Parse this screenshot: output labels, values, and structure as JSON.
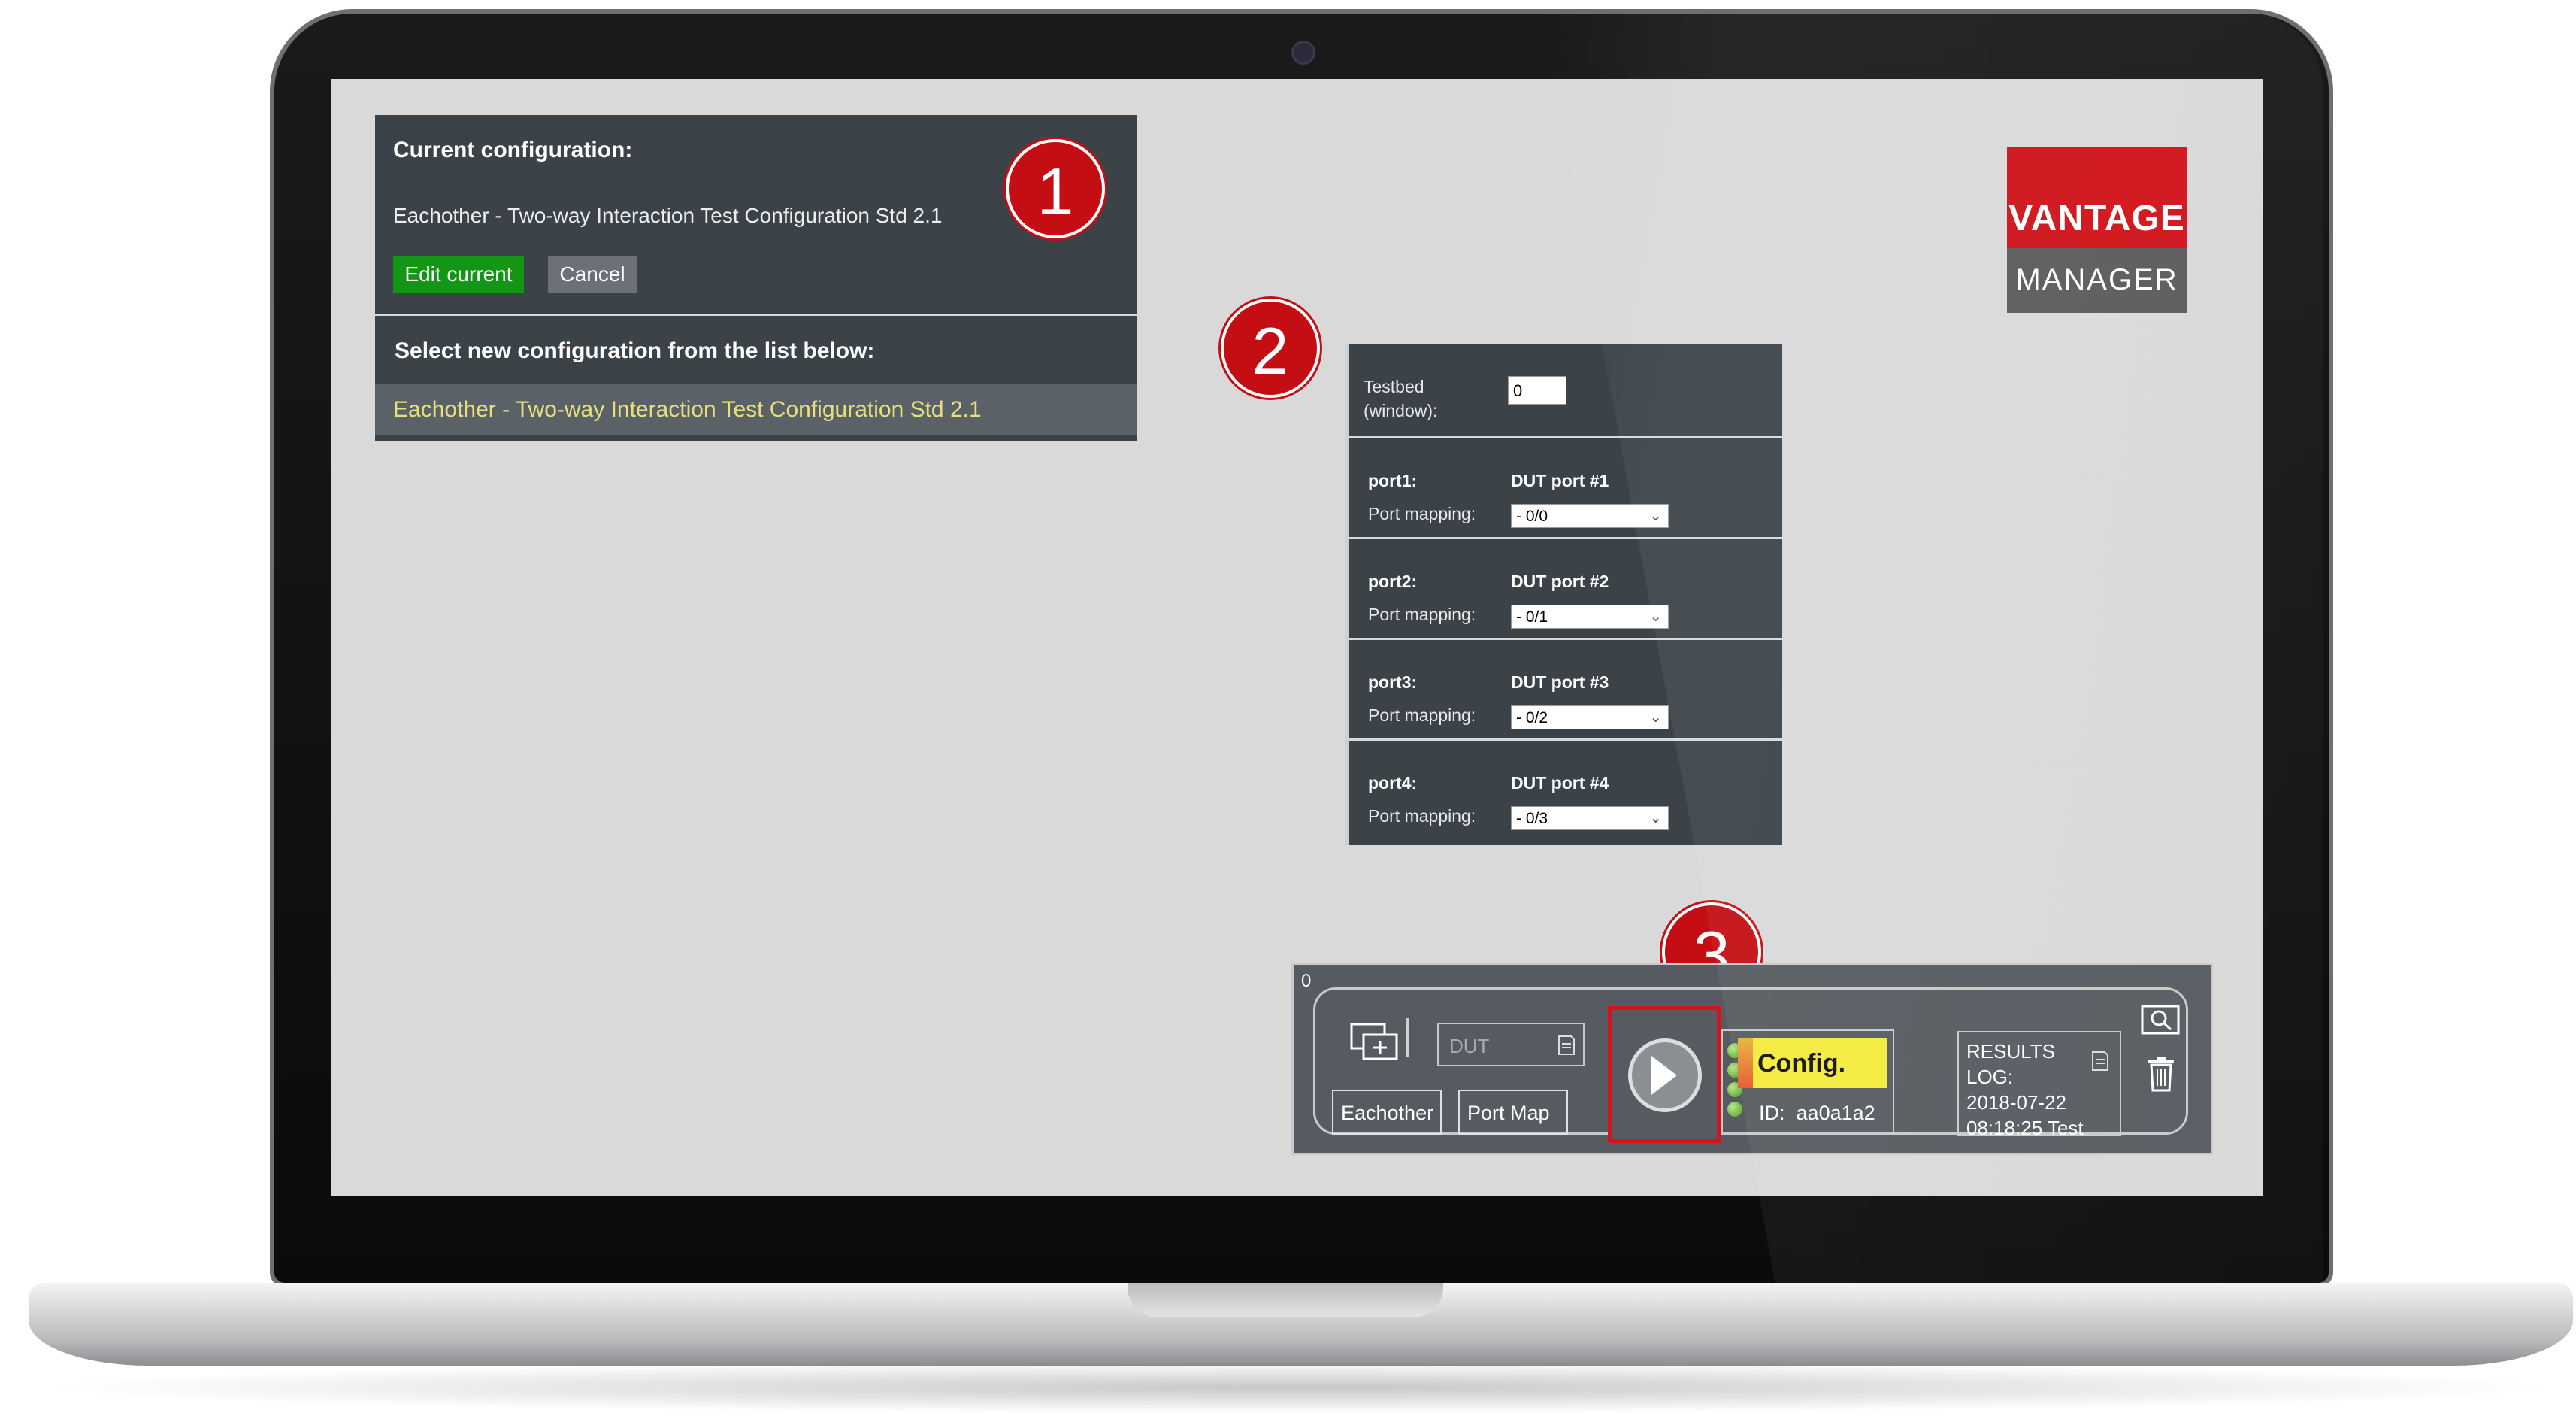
{
  "config_panel": {
    "heading": "Current configuration:",
    "current": "Eachother - Two-way Interaction Test Configuration Std 2.1",
    "edit_label": "Edit current",
    "cancel_label": "Cancel",
    "select_heading": "Select new configuration from the list below:",
    "items": [
      "Eachother - Two-way Interaction Test Configuration Std 2.1"
    ]
  },
  "badges": {
    "one": "1",
    "two": "2",
    "three": "3"
  },
  "logo": {
    "top": "VANTAGE",
    "bottom": "MANAGER"
  },
  "port_panel": {
    "testbed_label_line1": "Testbed",
    "testbed_label_line2": "(window):",
    "testbed_value": "0",
    "ports": [
      {
        "name": "port1:",
        "dut": "DUT port #1",
        "mapping_label": "Port mapping:",
        "mapping": "- 0/0"
      },
      {
        "name": "port2:",
        "dut": "DUT port #2",
        "mapping_label": "Port mapping:",
        "mapping": "- 0/1"
      },
      {
        "name": "port3:",
        "dut": "DUT port #3",
        "mapping_label": "Port mapping:",
        "mapping": "- 0/2"
      },
      {
        "name": "port4:",
        "dut": "DUT port #4",
        "mapping_label": "Port mapping:",
        "mapping": "- 0/3"
      }
    ]
  },
  "test_bar": {
    "index": "0",
    "dut_placeholder": "DUT",
    "eachother_label": "Eachother",
    "portmap_label": "Port Map",
    "status_label": "Config.",
    "id_label": "ID:",
    "id_value": "aa0a1a2",
    "results_line1": "RESULTS",
    "results_line2": "LOG:",
    "results_line3": "2018-07-22",
    "results_line4": "08:18:25 Test"
  },
  "colors": {
    "panel": "#3b4349",
    "screen": "#d9d9d9",
    "edit_green": "#139616",
    "badge_red": "#c40e14",
    "status_yellow": "#f4ea3c",
    "highlight_text": "#e8e07a"
  },
  "icons": [
    "add-screen-icon",
    "memory-card-icon",
    "play-icon",
    "zoom-icon",
    "trash-icon"
  ]
}
